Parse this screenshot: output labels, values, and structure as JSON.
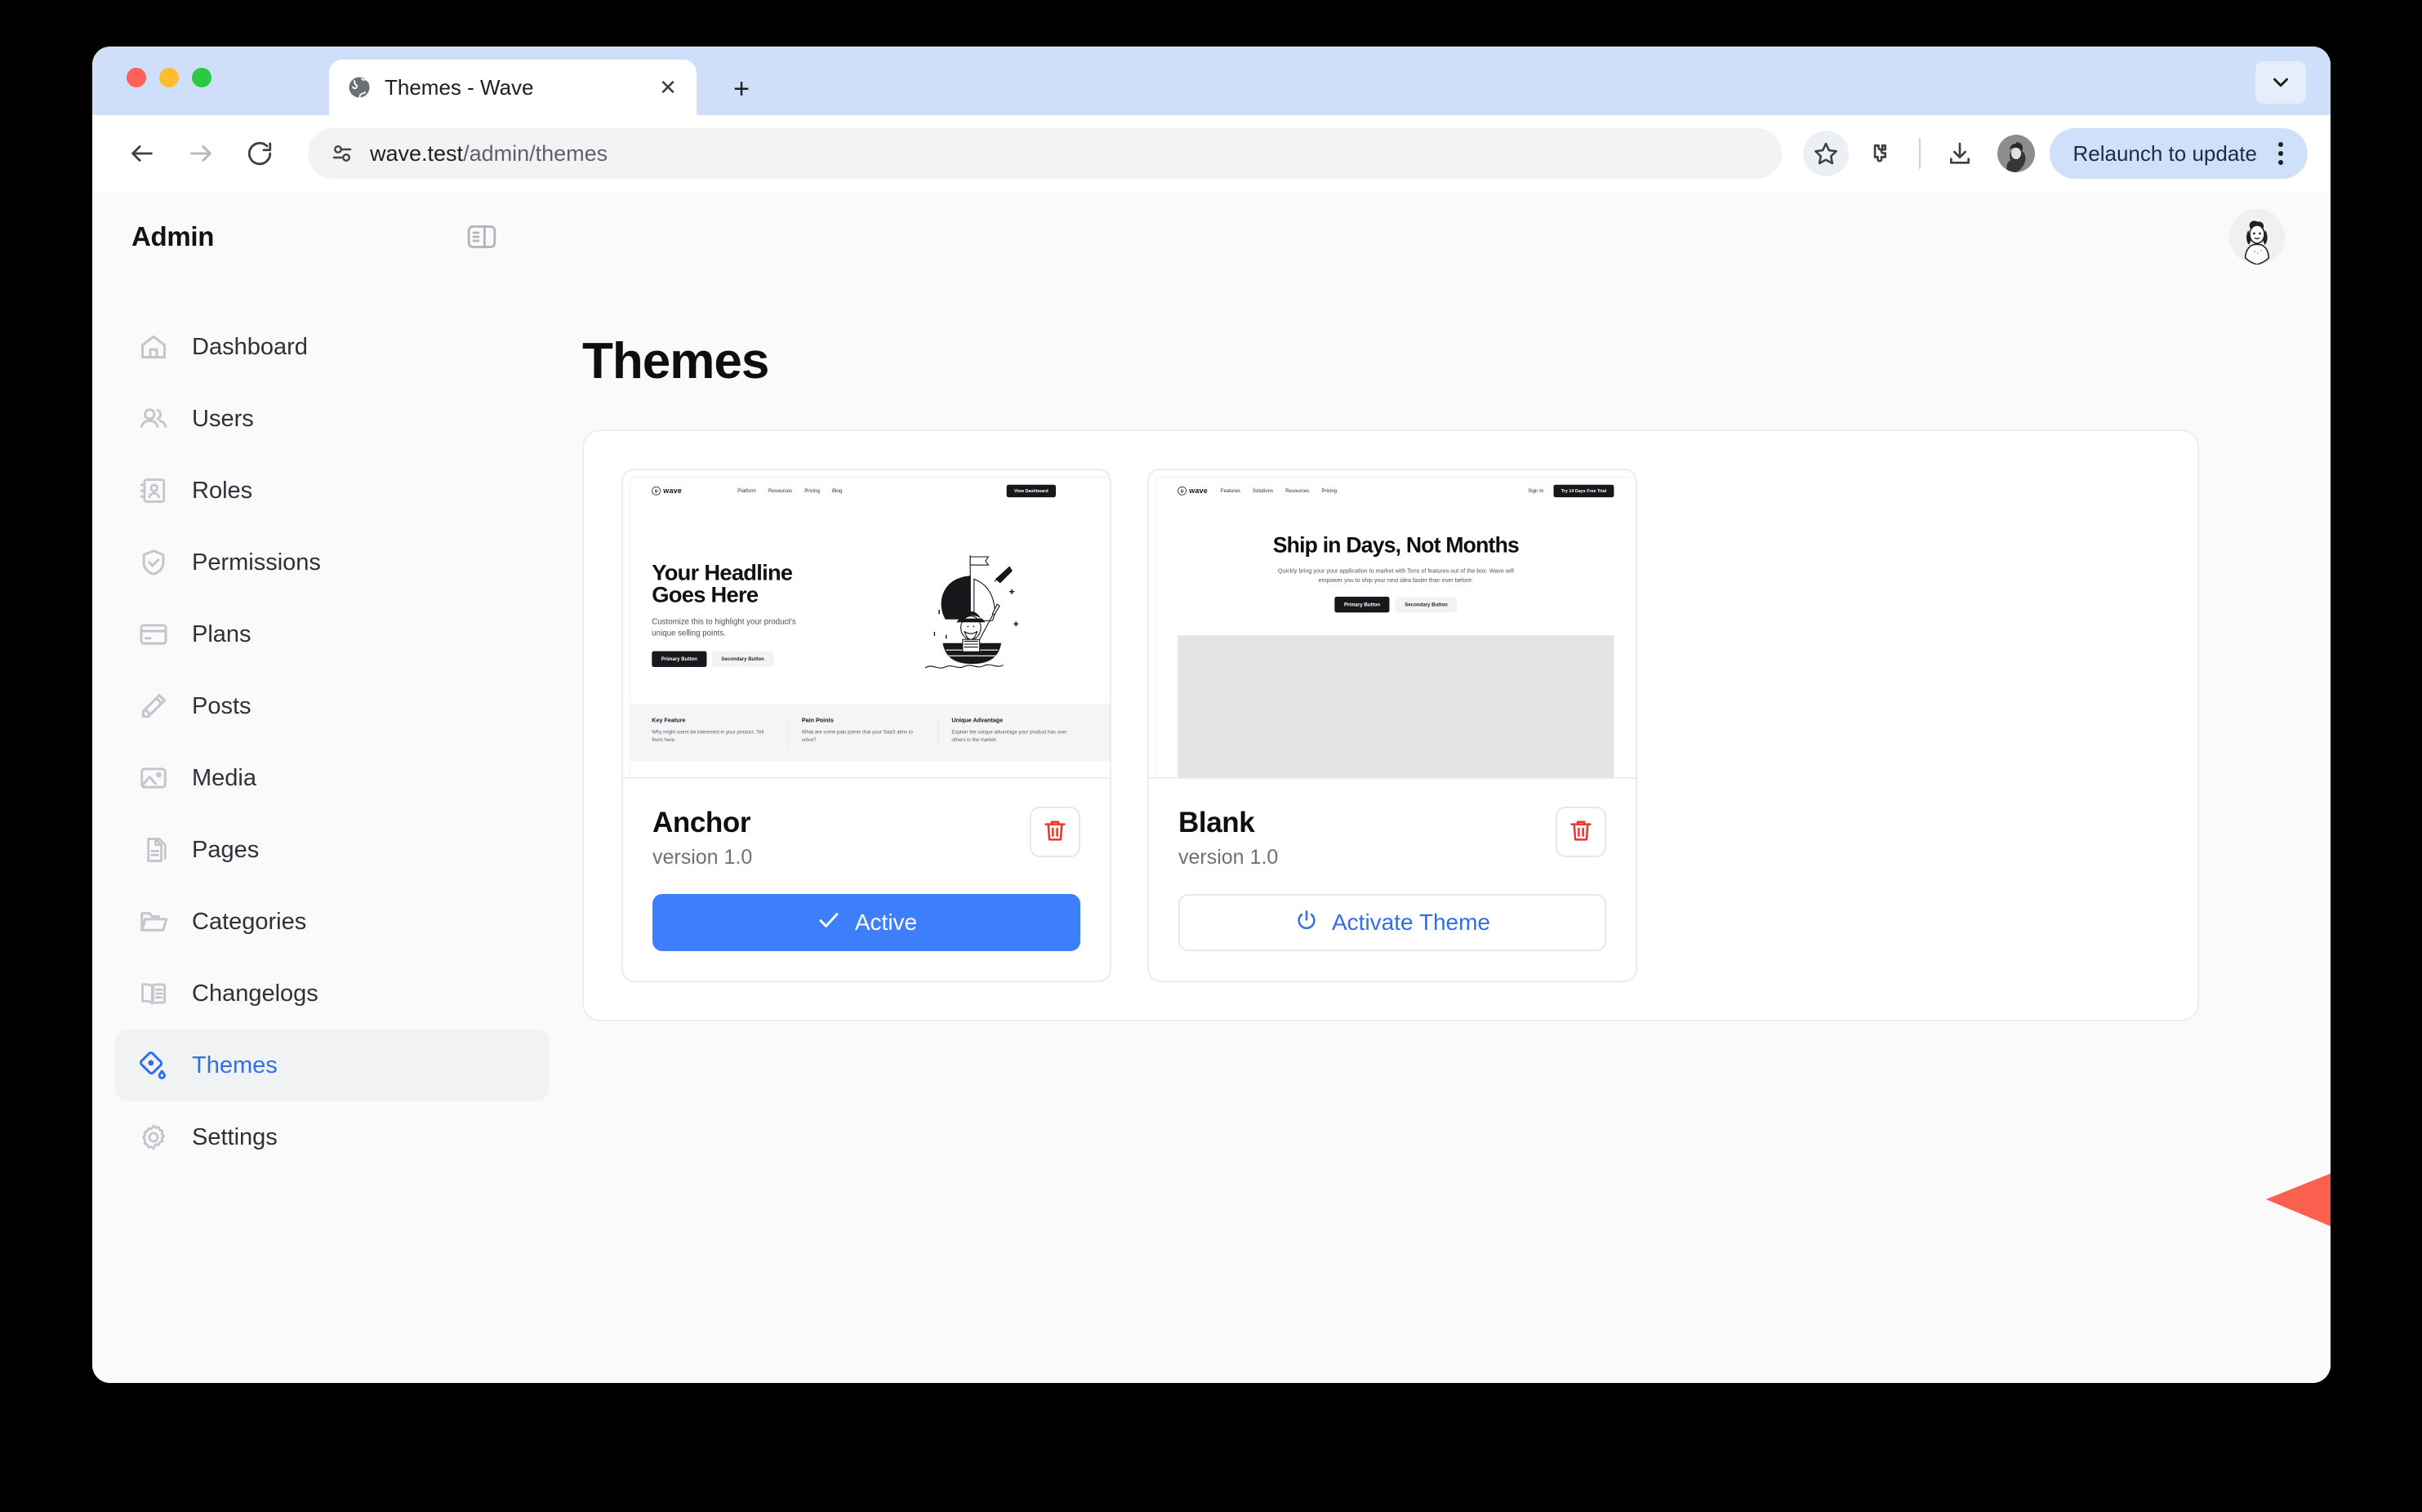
{
  "browser": {
    "tab": {
      "title": "Themes - Wave",
      "favicon": "globe-icon",
      "close": "✕"
    },
    "new_tab": "+",
    "toolbar": {
      "back": "←",
      "forward": "→",
      "reload": "⟳",
      "url_main": "wave.test",
      "url_path": "/admin/themes",
      "url_full": "wave.test/admin/themes",
      "relaunch_label": "Relaunch to update"
    }
  },
  "app": {
    "header": {
      "title": "Admin"
    },
    "sidebar": {
      "items": [
        {
          "label": "Dashboard",
          "icon": "home-icon",
          "active": false
        },
        {
          "label": "Users",
          "icon": "users-icon",
          "active": false
        },
        {
          "label": "Roles",
          "icon": "contact-book-icon",
          "active": false
        },
        {
          "label": "Permissions",
          "icon": "shield-check-icon",
          "active": false
        },
        {
          "label": "Plans",
          "icon": "credit-card-icon",
          "active": false
        },
        {
          "label": "Posts",
          "icon": "pencil-icon",
          "active": false
        },
        {
          "label": "Media",
          "icon": "image-icon",
          "active": false
        },
        {
          "label": "Pages",
          "icon": "documents-icon",
          "active": false
        },
        {
          "label": "Categories",
          "icon": "folder-icon",
          "active": false
        },
        {
          "label": "Changelogs",
          "icon": "open-book-icon",
          "active": false
        },
        {
          "label": "Themes",
          "icon": "paint-tag-icon",
          "active": true
        },
        {
          "label": "Settings",
          "icon": "gear-icon",
          "active": false
        }
      ]
    },
    "main": {
      "page_title": "Themes",
      "themes": [
        {
          "name": "Anchor",
          "version": "version 1.0",
          "action_label": "Active",
          "action_state": "active",
          "action_icon": "check-icon",
          "delete_icon": "trash-icon",
          "preview": {
            "logo": "wave",
            "nav_links": [
              "Platform",
              "Resources",
              "Pricing",
              "Blog"
            ],
            "nav_dropdowns": [
              "Platform",
              "Resources"
            ],
            "cta": "View Dashboard",
            "headline": "Your Headline Goes Here",
            "subheadline": "Customize this to highlight your product's unique selling points.",
            "primary_button": "Primary Button",
            "secondary_button": "Secondary Button",
            "art": "pirate-ship-illustration",
            "features": [
              {
                "title": "Key Feature",
                "desc": "Why might users be interested in your product. Tell them here."
              },
              {
                "title": "Pain Points",
                "desc": "What are some pain points that your SaaS aims to solve?"
              },
              {
                "title": "Unique Advantage",
                "desc": "Explain the unique advantage your product has over others in the market."
              }
            ]
          }
        },
        {
          "name": "Blank",
          "version": "version 1.0",
          "action_label": "Activate Theme",
          "action_state": "inactive",
          "action_icon": "power-icon",
          "delete_icon": "trash-icon",
          "preview": {
            "logo": "wave",
            "nav_links": [
              "Features",
              "Solutions",
              "Resources",
              "Pricing"
            ],
            "sign_in": "Sign In",
            "cta": "Try 14 Days Free Trial",
            "headline": "Ship in Days, Not Months",
            "subheadline": "Quickly bring your your application to market with Tons of features out of the box. Wave will empower you to ship your next idea faster than ever before.",
            "primary_button": "Primary Button",
            "secondary_button": "Secondary Button"
          }
        }
      ]
    }
  },
  "annotation": {
    "type": "arrow-pointing-left",
    "target": "activate-theme-button",
    "color": "#f9604d"
  },
  "colors": {
    "accent_blue": "#2f6fed",
    "active_button": "#3d7efa",
    "danger_red": "#f0342b",
    "annotation_red": "#f9604d",
    "page_bg": "#fafafa",
    "tabstrip_bg": "#cfdef9"
  }
}
